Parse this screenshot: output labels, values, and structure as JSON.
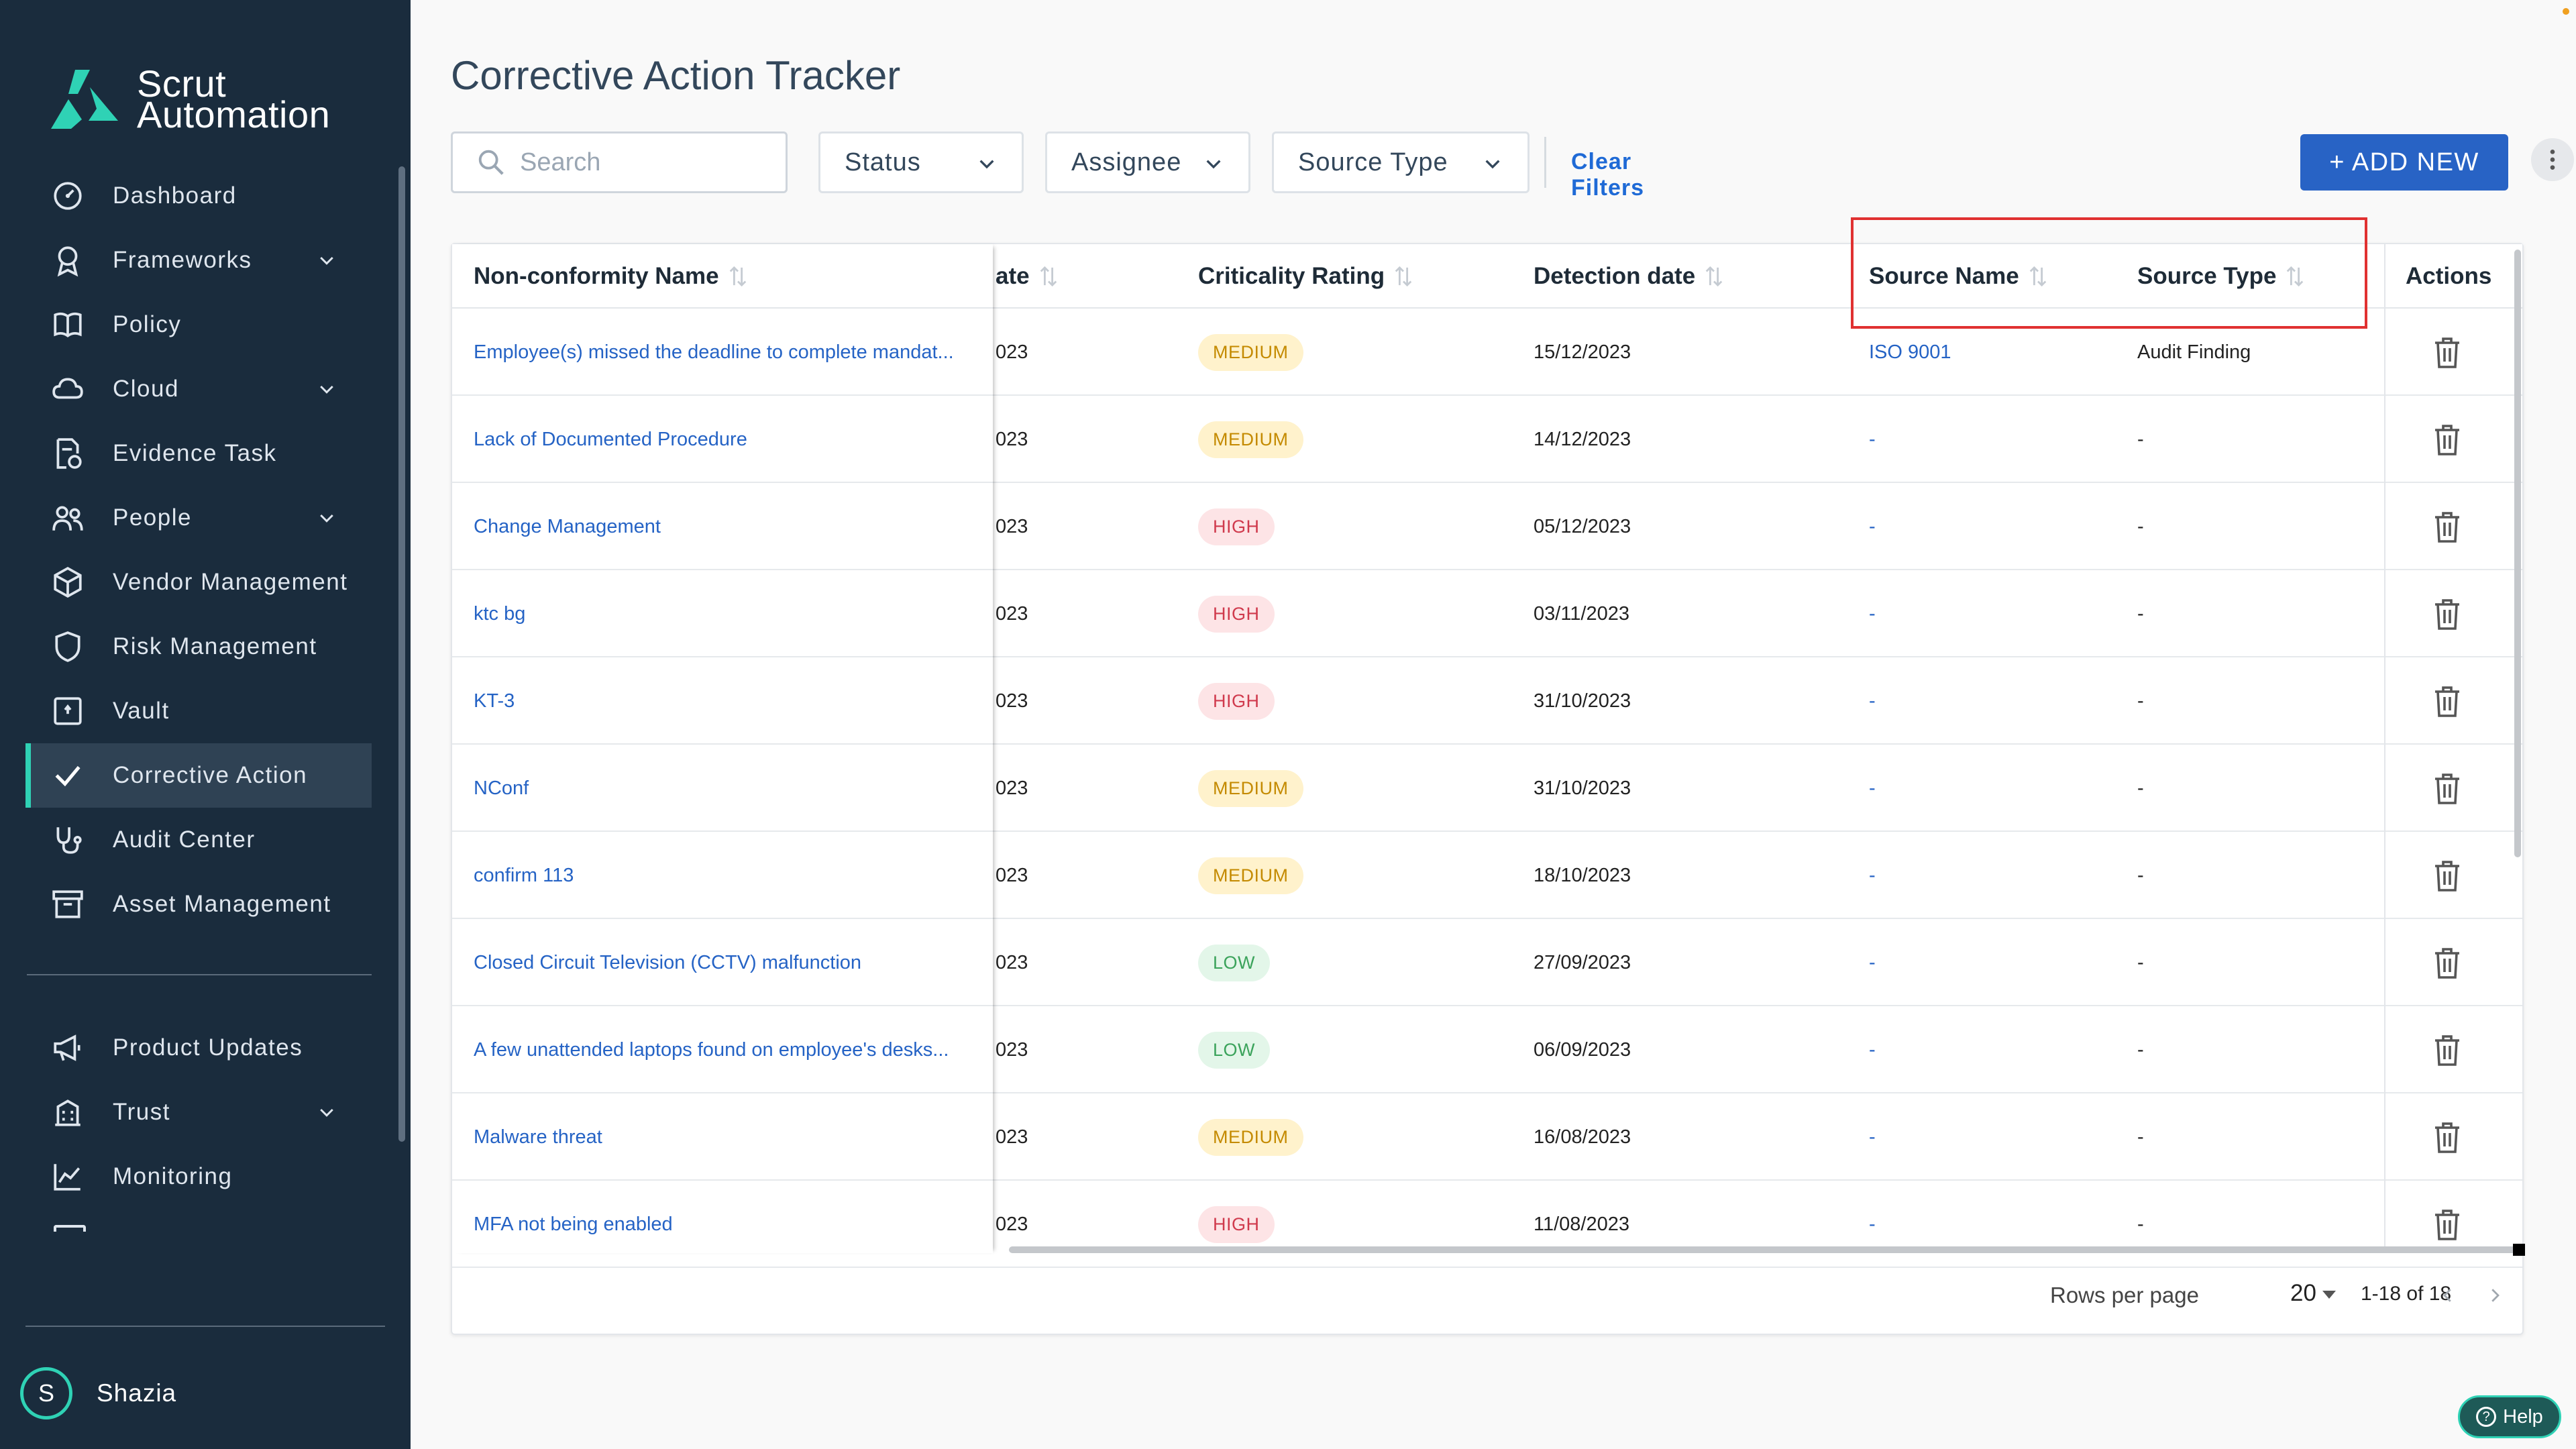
{
  "brand": {
    "line1": "Scrut",
    "line2": "Automation",
    "accent_color": "#2fd2b5"
  },
  "sidebar": {
    "items": [
      {
        "label": "Dashboard",
        "icon": "gauge-icon",
        "expandable": false,
        "active": false
      },
      {
        "label": "Frameworks",
        "icon": "award-icon",
        "expandable": true,
        "active": false
      },
      {
        "label": "Policy",
        "icon": "book-icon",
        "expandable": false,
        "active": false
      },
      {
        "label": "Cloud",
        "icon": "cloud-icon",
        "expandable": true,
        "active": false
      },
      {
        "label": "Evidence Task",
        "icon": "file-check-icon",
        "expandable": false,
        "active": false
      },
      {
        "label": "People",
        "icon": "people-icon",
        "expandable": true,
        "active": false
      },
      {
        "label": "Vendor Management",
        "icon": "box-icon",
        "expandable": false,
        "active": false
      },
      {
        "label": "Risk Management",
        "icon": "shield-icon",
        "expandable": false,
        "active": false
      },
      {
        "label": "Vault",
        "icon": "vault-icon",
        "expandable": false,
        "active": false
      },
      {
        "label": "Corrective Action",
        "icon": "check-icon",
        "expandable": false,
        "active": true
      },
      {
        "label": "Audit Center",
        "icon": "stethoscope-icon",
        "expandable": false,
        "active": false
      },
      {
        "label": "Asset Management",
        "icon": "archive-icon",
        "expandable": false,
        "active": false
      }
    ],
    "bottom_items": [
      {
        "label": "Product Updates",
        "icon": "megaphone-icon",
        "expandable": false
      },
      {
        "label": "Trust",
        "icon": "building-icon",
        "expandable": true
      },
      {
        "label": "Monitoring",
        "icon": "chart-line-icon",
        "expandable": false
      }
    ],
    "user": {
      "initial": "S",
      "name": "Shazia"
    }
  },
  "page": {
    "title": "Corrective Action Tracker"
  },
  "filters": {
    "search_placeholder": "Search",
    "status_label": "Status",
    "assignee_label": "Assignee",
    "source_type_label": "Source Type",
    "clear_label": "Clear Filters",
    "add_new_label": "+ ADD NEW"
  },
  "table": {
    "columns": {
      "name": "Non-conformity Name",
      "date": "ate",
      "criticality": "Criticality Rating",
      "detection": "Detection date",
      "source_name": "Source Name",
      "source_type": "Source Type",
      "actions": "Actions"
    },
    "rows": [
      {
        "name": "Employee(s) missed the deadline to complete mandat...",
        "date": "023",
        "criticality": "MEDIUM",
        "level": "medium",
        "detection": "15/12/2023",
        "source_name": "ISO 9001",
        "source_type": "Audit Finding"
      },
      {
        "name": "Lack of Documented Procedure",
        "date": "023",
        "criticality": "MEDIUM",
        "level": "medium",
        "detection": "14/12/2023",
        "source_name": "-",
        "source_type": "-"
      },
      {
        "name": "Change Management",
        "date": "023",
        "criticality": "HIGH",
        "level": "high",
        "detection": "05/12/2023",
        "source_name": "-",
        "source_type": "-"
      },
      {
        "name": "ktc bg",
        "date": "023",
        "criticality": "HIGH",
        "level": "high",
        "detection": "03/11/2023",
        "source_name": "-",
        "source_type": "-"
      },
      {
        "name": "KT-3",
        "date": "023",
        "criticality": "HIGH",
        "level": "high",
        "detection": "31/10/2023",
        "source_name": "-",
        "source_type": "-"
      },
      {
        "name": "NConf",
        "date": "023",
        "criticality": "MEDIUM",
        "level": "medium",
        "detection": "31/10/2023",
        "source_name": "-",
        "source_type": "-"
      },
      {
        "name": "confirm 113",
        "date": "023",
        "criticality": "MEDIUM",
        "level": "medium",
        "detection": "18/10/2023",
        "source_name": "-",
        "source_type": "-"
      },
      {
        "name": "Closed Circuit Television (CCTV) malfunction",
        "date": "023",
        "criticality": "LOW",
        "level": "low",
        "detection": "27/09/2023",
        "source_name": "-",
        "source_type": "-"
      },
      {
        "name": "A few unattended laptops found on employee's desks...",
        "date": "023",
        "criticality": "LOW",
        "level": "low",
        "detection": "06/09/2023",
        "source_name": "-",
        "source_type": "-"
      },
      {
        "name": "Malware threat",
        "date": "023",
        "criticality": "MEDIUM",
        "level": "medium",
        "detection": "16/08/2023",
        "source_name": "-",
        "source_type": "-"
      },
      {
        "name": "MFA not being enabled",
        "date": "023",
        "criticality": "HIGH",
        "level": "high",
        "detection": "11/08/2023",
        "source_name": "-",
        "source_type": "-"
      }
    ]
  },
  "pagination": {
    "rows_label": "Rows per page",
    "rows_value": "20",
    "range": "1-18 of 18"
  },
  "help": {
    "label": "Help"
  }
}
